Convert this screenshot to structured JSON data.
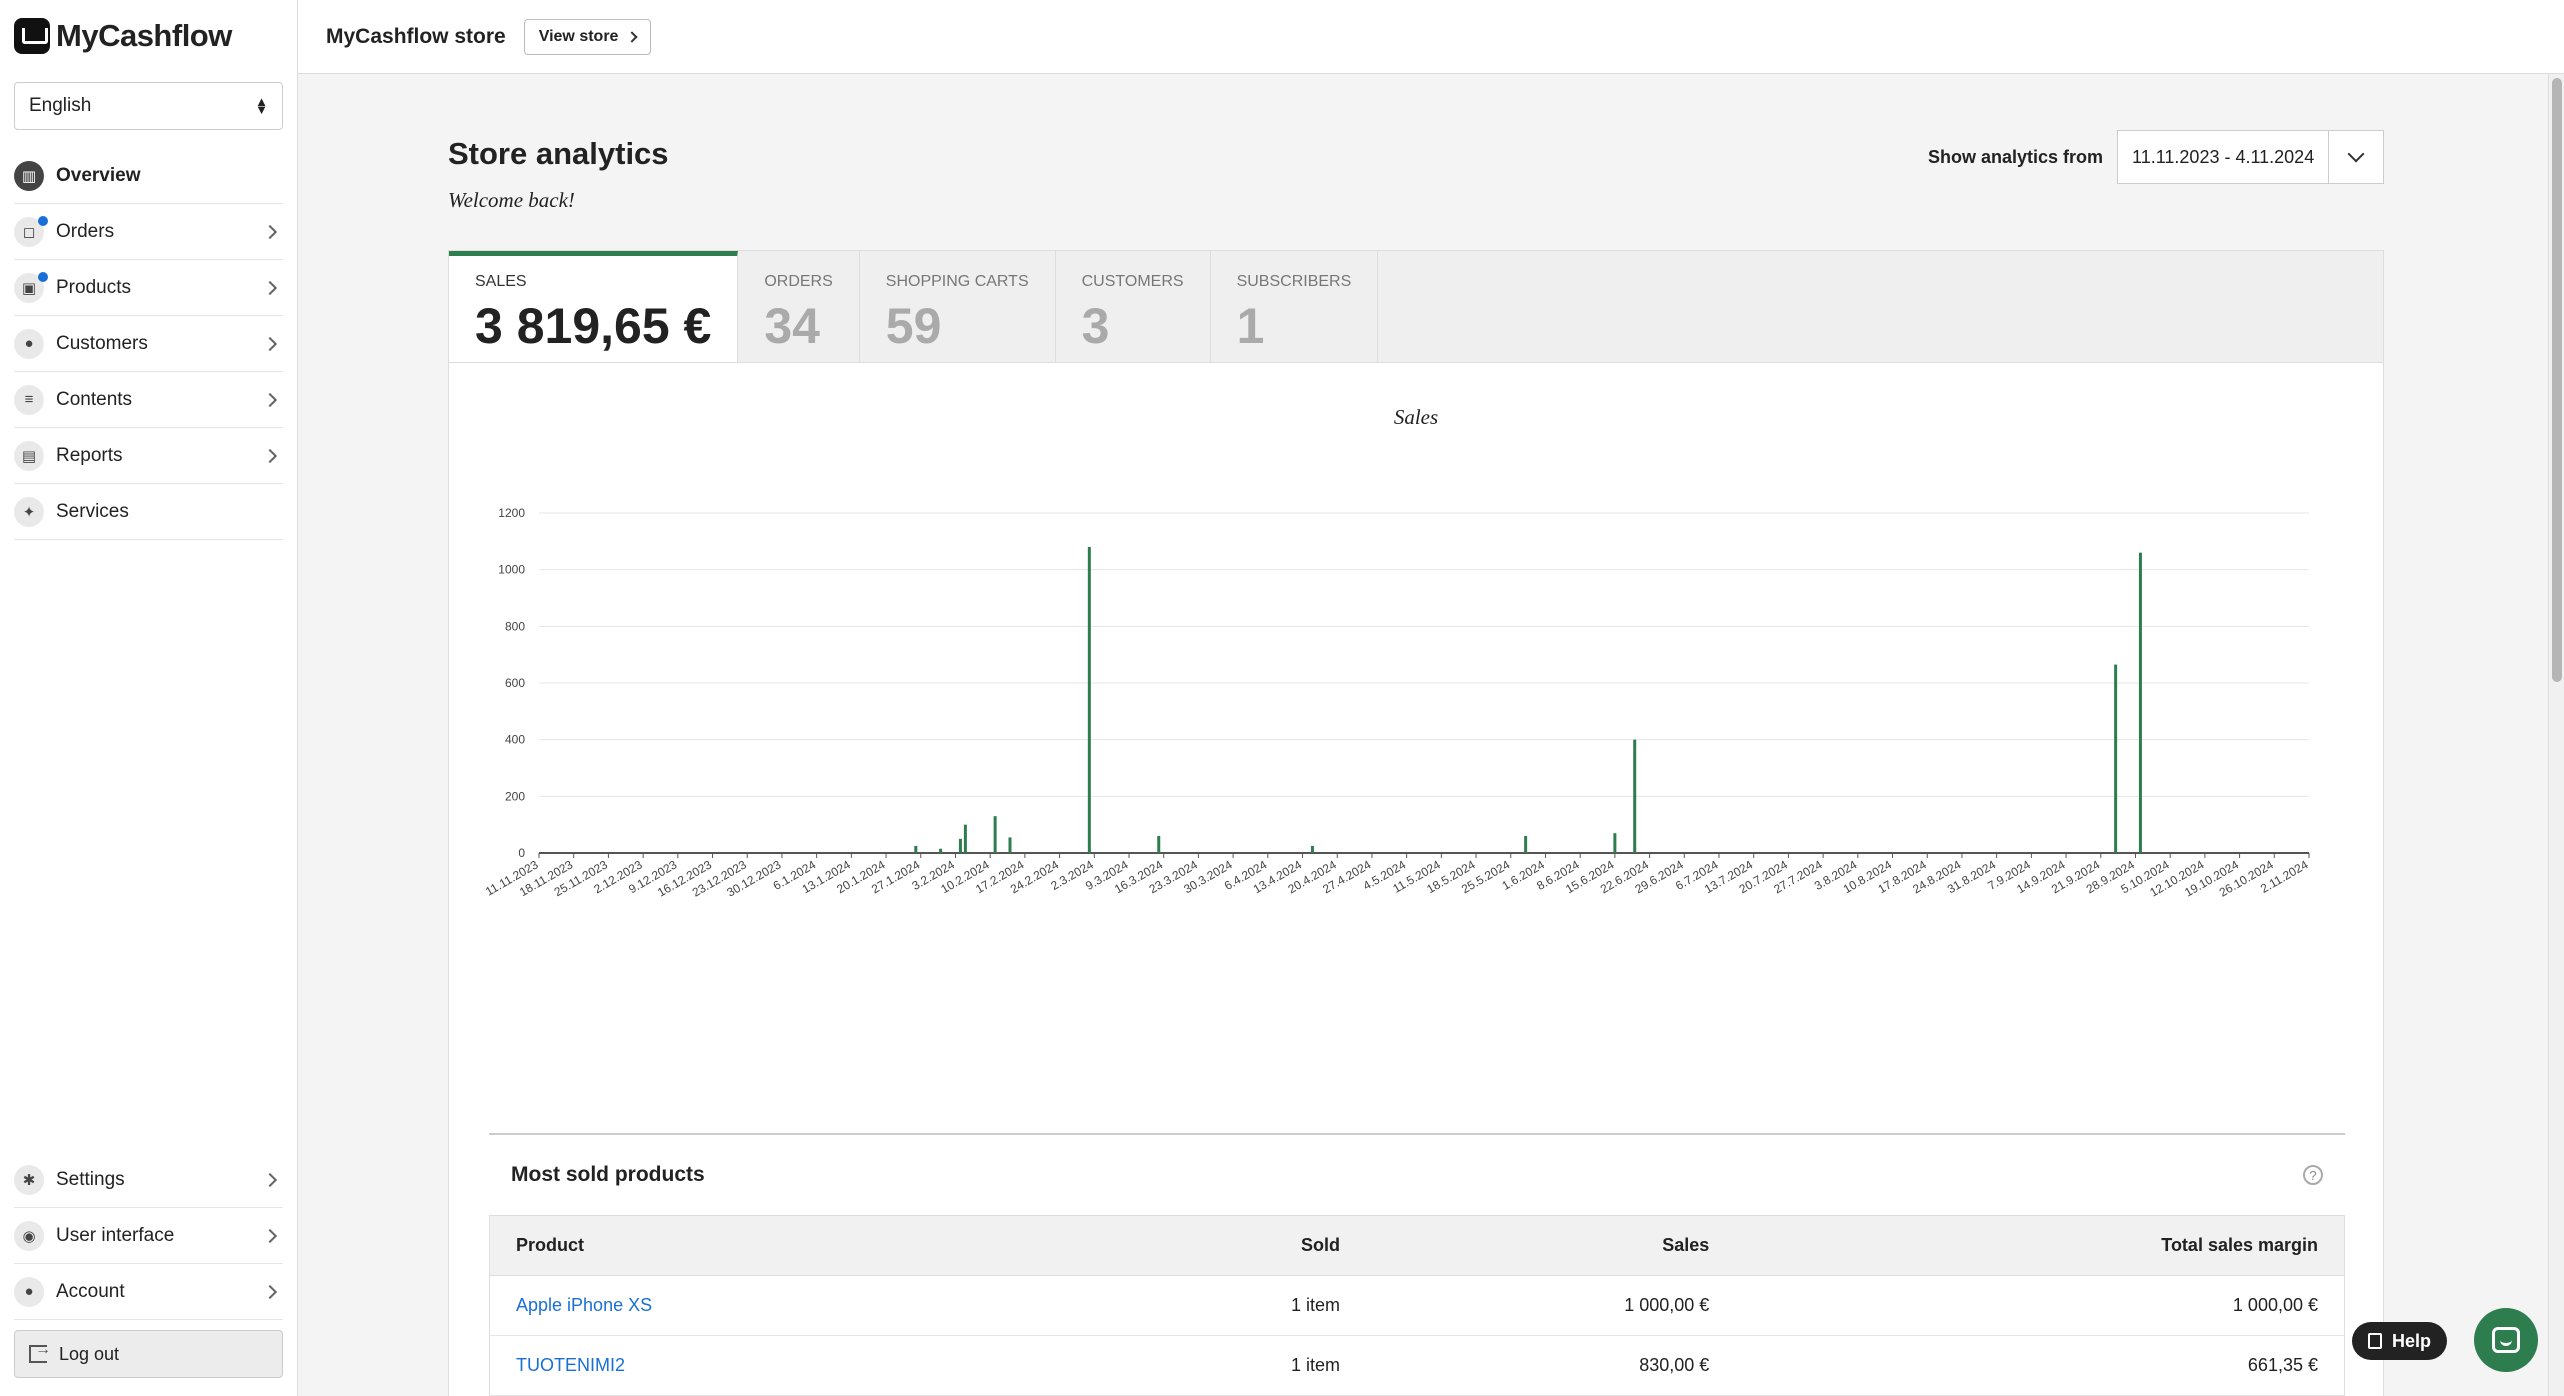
{
  "app": {
    "logo_text": "MyCashflow"
  },
  "sidebar": {
    "language": "English",
    "items": [
      {
        "label": "Overview",
        "icon": "chart-icon",
        "active": true,
        "badge": false,
        "chevron": false
      },
      {
        "label": "Orders",
        "icon": "bag-icon",
        "active": false,
        "badge": true,
        "chevron": true
      },
      {
        "label": "Products",
        "icon": "box-icon",
        "active": false,
        "badge": true,
        "chevron": true
      },
      {
        "label": "Customers",
        "icon": "users-icon",
        "active": false,
        "badge": false,
        "chevron": true
      },
      {
        "label": "Contents",
        "icon": "lines-icon",
        "active": false,
        "badge": false,
        "chevron": true
      },
      {
        "label": "Reports",
        "icon": "report-icon",
        "active": false,
        "badge": false,
        "chevron": true
      },
      {
        "label": "Services",
        "icon": "puzzle-icon",
        "active": false,
        "badge": false,
        "chevron": false
      }
    ],
    "bottom_items": [
      {
        "label": "Settings",
        "icon": "gear-icon"
      },
      {
        "label": "User interface",
        "icon": "drop-icon"
      },
      {
        "label": "Account",
        "icon": "person-icon"
      }
    ],
    "logout_label": "Log out"
  },
  "topbar": {
    "store_name": "MyCashflow store",
    "view_store_label": "View store"
  },
  "main": {
    "title": "Store analytics",
    "welcome": "Welcome back!",
    "range_label": "Show analytics from",
    "range_value": "11.11.2023 - 4.11.2024",
    "tabs": [
      {
        "label": "Sales",
        "value": "3 819,65 €"
      },
      {
        "label": "Orders",
        "value": "34"
      },
      {
        "label": "Shopping carts",
        "value": "59"
      },
      {
        "label": "Customers",
        "value": "3"
      },
      {
        "label": "Subscribers",
        "value": "1"
      }
    ],
    "accent_color": "#2e7d4f"
  },
  "chart_data": {
    "type": "bar",
    "title": "Sales",
    "xlabel": "",
    "ylabel": "",
    "ylim": [
      0,
      1200
    ],
    "yticks": [
      0,
      200,
      400,
      600,
      800,
      1000,
      1200
    ],
    "x_ticks": [
      "11.11.2023",
      "18.11.2023",
      "25.11.2023",
      "2.12.2023",
      "9.12.2023",
      "16.12.2023",
      "23.12.2023",
      "30.12.2023",
      "6.1.2024",
      "13.1.2024",
      "20.1.2024",
      "27.1.2024",
      "3.2.2024",
      "10.2.2024",
      "17.2.2024",
      "24.2.2024",
      "2.3.2024",
      "9.3.2024",
      "16.3.2024",
      "23.3.2024",
      "30.3.2024",
      "6.4.2024",
      "13.4.2024",
      "20.4.2024",
      "27.4.2024",
      "4.5.2024",
      "11.5.2024",
      "18.5.2024",
      "25.5.2024",
      "1.6.2024",
      "8.6.2024",
      "15.6.2024",
      "22.6.2024",
      "29.6.2024",
      "6.7.2024",
      "13.7.2024",
      "20.7.2024",
      "27.7.2024",
      "3.8.2024",
      "10.8.2024",
      "17.8.2024",
      "24.8.2024",
      "31.8.2024",
      "7.9.2024",
      "14.9.2024",
      "21.9.2024",
      "28.9.2024",
      "5.10.2024",
      "12.10.2024",
      "19.10.2024",
      "26.10.2024",
      "2.11.2024"
    ],
    "bars": [
      {
        "date": "26.1.2024",
        "value": 25
      },
      {
        "date": "31.1.2024",
        "value": 15
      },
      {
        "date": "4.2.2024",
        "value": 50
      },
      {
        "date": "5.2.2024",
        "value": 100
      },
      {
        "date": "11.2.2024",
        "value": 130
      },
      {
        "date": "14.2.2024",
        "value": 55
      },
      {
        "date": "1.3.2024",
        "value": 1080
      },
      {
        "date": "15.3.2024",
        "value": 60
      },
      {
        "date": "15.4.2024",
        "value": 25
      },
      {
        "date": "28.5.2024",
        "value": 60
      },
      {
        "date": "15.6.2024",
        "value": 70
      },
      {
        "date": "19.6.2024",
        "value": 400
      },
      {
        "date": "24.9.2024",
        "value": 665
      },
      {
        "date": "29.9.2024",
        "value": 1060
      }
    ],
    "bar_color": "#2e7d4f",
    "grid": true
  },
  "most_sold": {
    "title": "Most sold products",
    "columns": [
      "Product",
      "Sold",
      "Sales",
      "Total sales margin"
    ],
    "rows": [
      [
        "Apple iPhone XS",
        "1 item",
        "1 000,00 €",
        "1 000,00 €"
      ],
      [
        "TUOTENIMI2",
        "1 item",
        "830,00 €",
        "661,35 €"
      ]
    ]
  },
  "widgets": {
    "help_label": "Help"
  }
}
